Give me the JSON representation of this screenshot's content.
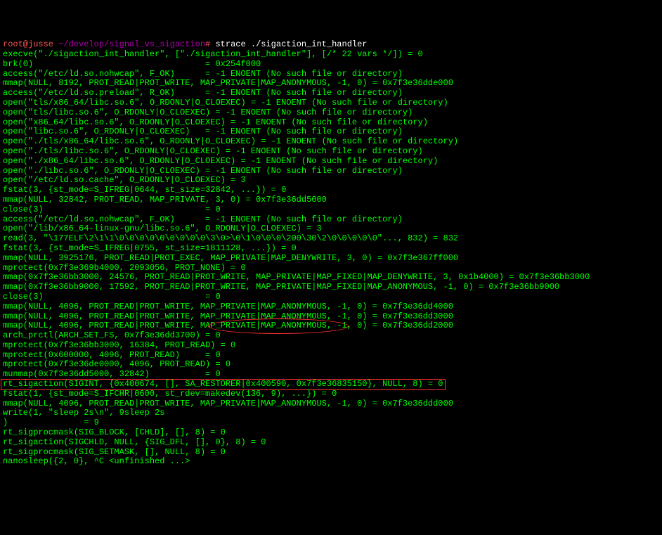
{
  "prompt": {
    "user": "root@jusse",
    "path": "~/develop/signal_vs_sigaction",
    "sep": "#",
    "command": "strace ./sigaction_int_handler"
  },
  "lines": [
    "execve(\"./sigaction_int_handler\", [\"./sigaction_int_handler\"], [/* 22 vars */]) = 0",
    "brk(0)                                  = 0x254f000",
    "access(\"/etc/ld.so.nohwcap\", F_OK)      = -1 ENOENT (No such file or directory)",
    "mmap(NULL, 8192, PROT_READ|PROT_WRITE, MAP_PRIVATE|MAP_ANONYMOUS, -1, 0) = 0x7f3e36dde000",
    "access(\"/etc/ld.so.preload\", R_OK)      = -1 ENOENT (No such file or directory)",
    "open(\"tls/x86_64/libc.so.6\", O_RDONLY|O_CLOEXEC) = -1 ENOENT (No such file or directory)",
    "open(\"tls/libc.so.6\", O_RDONLY|O_CLOEXEC) = -1 ENOENT (No such file or directory)",
    "open(\"x86_64/libc.so.6\", O_RDONLY|O_CLOEXEC) = -1 ENOENT (No such file or directory)",
    "open(\"libc.so.6\", O_RDONLY|O_CLOEXEC)   = -1 ENOENT (No such file or directory)",
    "open(\"./tls/x86_64/libc.so.6\", O_RDONLY|O_CLOEXEC) = -1 ENOENT (No such file or directory)",
    "open(\"./tls/libc.so.6\", O_RDONLY|O_CLOEXEC) = -1 ENOENT (No such file or directory)",
    "open(\"./x86_64/libc.so.6\", O_RDONLY|O_CLOEXEC) = -1 ENOENT (No such file or directory)",
    "open(\"./libc.so.6\", O_RDONLY|O_CLOEXEC) = -1 ENOENT (No such file or directory)",
    "open(\"/etc/ld.so.cache\", O_RDONLY|O_CLOEXEC) = 3",
    "fstat(3, {st_mode=S_IFREG|0644, st_size=32842, ...}) = 0",
    "mmap(NULL, 32842, PROT_READ, MAP_PRIVATE, 3, 0) = 0x7f3e36dd5000",
    "close(3)                                = 0",
    "access(\"/etc/ld.so.nohwcap\", F_OK)      = -1 ENOENT (No such file or directory)",
    "open(\"/lib/x86_64-linux-gnu/libc.so.6\", O_RDONLY|O_CLOEXEC) = 3",
    "read(3, \"\\177ELF\\2\\1\\1\\0\\0\\0\\0\\0\\0\\0\\0\\0\\3\\0>\\0\\1\\0\\0\\0\\200\\30\\2\\0\\0\\0\\0\\0\"..., 832) = 832",
    "fstat(3, {st_mode=S_IFREG|0755, st_size=1811128, ...}) = 0",
    "mmap(NULL, 3925176, PROT_READ|PROT_EXEC, MAP_PRIVATE|MAP_DENYWRITE, 3, 0) = 0x7f3e367ff000",
    "mprotect(0x7f3e369b4000, 2093056, PROT_NONE) = 0",
    "mmap(0x7f3e36bb3000, 24576, PROT_READ|PROT_WRITE, MAP_PRIVATE|MAP_FIXED|MAP_DENYWRITE, 3, 0x1b4000) = 0x7f3e36bb3000",
    "mmap(0x7f3e36bb9000, 17592, PROT_READ|PROT_WRITE, MAP_PRIVATE|MAP_FIXED|MAP_ANONYMOUS, -1, 0) = 0x7f3e36bb9000",
    "close(3)                                = 0",
    "mmap(NULL, 4096, PROT_READ|PROT_WRITE, MAP_PRIVATE|MAP_ANONYMOUS, -1, 0) = 0x7f3e36dd4000",
    "mmap(NULL, 4096, PROT_READ|PROT_WRITE, MAP_PRIVATE|MAP_ANONYMOUS, -1, 0) = 0x7f3e36dd3000",
    "mmap(NULL, 4096, PROT_READ|PROT_WRITE, MAP_PRIVATE|MAP_ANONYMOUS, -1, 0) = 0x7f3e36dd2000",
    "arch_prctl(ARCH_SET_FS, 0x7f3e36dd3700) = 0",
    "mprotect(0x7f3e36bb3000, 16384, PROT_READ) = 0",
    "mprotect(0x600000, 4096, PROT_READ)     = 0",
    "mprotect(0x7f3e36de0000, 4096, PROT_READ) = 0",
    "munmap(0x7f3e36dd5000, 32842)           = 0"
  ],
  "highlight_line": "rt_sigaction(SIGINT, {0x400674, [], SA_RESTORER|0x400590, 0x7f3e36835150}, NULL, 8) = 0",
  "tail_lines": [
    "fstat(1, {st_mode=S_IFCHR|0600, st_rdev=makedev(136, 9), ...}) = 0",
    "mmap(NULL, 4096, PROT_READ|PROT_WRITE, MAP_PRIVATE|MAP_ANONYMOUS, -1, 0) = 0x7f3e36ddd000",
    "write(1, \"sleep 2s\\n\", 9sleep 2s",
    ")               = 9",
    "rt_sigprocmask(SIG_BLOCK, [CHLD], [], 8) = 0",
    "rt_sigaction(SIGCHLD, NULL, {SIG_DFL, [], 0}, 8) = 0",
    "rt_sigprocmask(SIG_SETMASK, [], NULL, 8) = 0",
    "nanosleep({2, 0}, ^C <unfinished ...>"
  ]
}
